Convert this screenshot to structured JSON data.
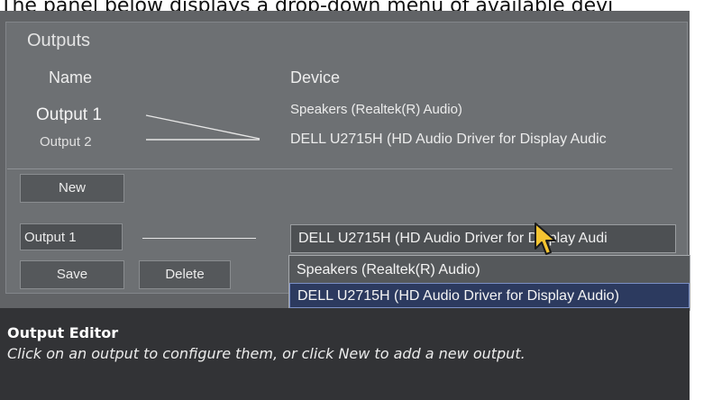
{
  "caption": "The panel below displays a drop-down menu of available devi",
  "outputs_panel": {
    "title": "Outputs",
    "column_name": "Name",
    "column_device": "Device",
    "outputs": [
      {
        "name": "Output 1",
        "device": "Speakers (Realtek(R) Audio)"
      },
      {
        "name": "Output 2",
        "device": "DELL U2715H (HD Audio Driver for Display Audic"
      }
    ]
  },
  "editor_controls": {
    "new_button": "New",
    "output_field_value": "Output 1",
    "device_select_value": "DELL U2715H (HD Audio Driver for Display Audi",
    "save_button": "Save",
    "delete_button": "Delete",
    "dropdown_options": [
      {
        "label": "Speakers (Realtek(R) Audio)",
        "selected": false
      },
      {
        "label": "DELL U2715H (HD Audio Driver for Display Audio)",
        "selected": true
      }
    ]
  },
  "output_editor": {
    "title": "Output Editor",
    "description": "Click on an output to configure them, or click New to add a new output."
  },
  "colors": {
    "panel_bg": "#616366",
    "editor_bg": "#323336",
    "selected_option": "#2c3a5f",
    "cursor": "#f5c431"
  },
  "icons": {
    "pointer": "mouse-pointer-icon"
  }
}
